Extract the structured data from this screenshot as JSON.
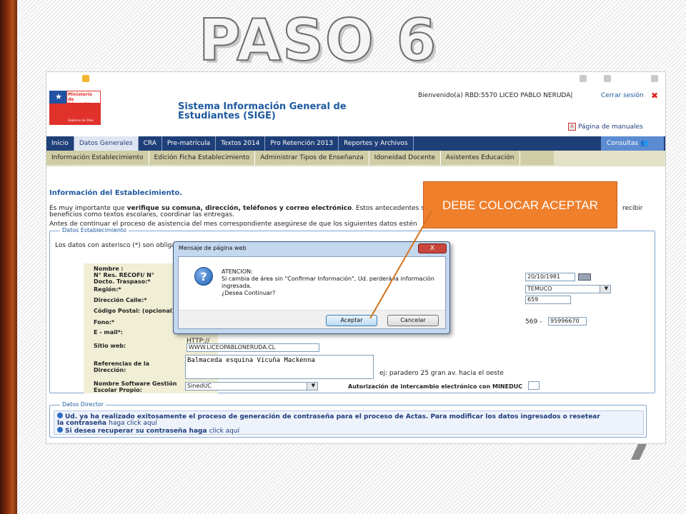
{
  "slide_title": "PASO 6",
  "callout": "DEBE COLOCAR ACEPTAR",
  "header": {
    "ministry": "Ministerio de Educación",
    "gov": "Gobierno de Chile",
    "system_name": "Sistema Información General de Estudiantes (SIGE)",
    "welcome": "Bienvenido(a) RBD:5570  LICEO PABLO NERUDA|",
    "logout": "Cerrar sesión",
    "manual": "Página de manuales"
  },
  "nav": {
    "tabs": [
      "Inicio",
      "Datos Generales",
      "CRA",
      "Pre-matrícula",
      "Textos 2014",
      "Pro Retención 2013",
      "Reportes y Archivos"
    ],
    "active": "Datos Generales",
    "consultas": "Consultas"
  },
  "subnav": [
    "Información Establecimiento",
    "Edición Ficha Establecimiento",
    "Administrar Tipos de Enseñanza",
    "Idoneidad Docente",
    "Asistentes Educación"
  ],
  "content": {
    "heading": "Información del Establecimiento.",
    "intro_a": "Es muy importante que",
    "intro_b": "verifique su comuna, dirección, teléfonos y correo electrónico",
    "intro_c": ". Estos antecedentes serán utilizados para el despacho de",
    "intro_d": "recibir",
    "intro_line2": "beneficios como textos escolares, coordinar las entregas.",
    "intro_line3": "Antes de continuar el proceso de asistencia del mes correspondiente asegúrese de que los siguientes datos estén",
    "fieldset_legend": "Datos Establecimiento",
    "asterisk_note": "Los datos con asterisco (*) son obligatorios",
    "labels": {
      "nombre": "Nombre :",
      "recofi": "N° Res. RECOFI/ N° Docto. Traspaso:*",
      "region": "Región:*",
      "direccion": "Dirección Calle:*",
      "postal": "Código Postal: (opcional)",
      "fono": "Fono:*",
      "email": "E - mail*:",
      "web": "Sitio web:",
      "referencias": "Referencias de la Dirección:",
      "software": "Nombre Software Gestión Escolar Propio:",
      "autorizacion": "Autorización de intercambio electrónico con MINEDUC"
    },
    "values": {
      "fecha": "20/10/1981",
      "comuna": "TEMUCO",
      "numero": "659",
      "fono_code": "569 -",
      "fono": "95996670",
      "http": "HTTP://",
      "web": "WWW.LICEOPABLONERUDA.CL",
      "referencias": "Balmaceda esquina Vicuña Mackenna",
      "ref_hint": "ej: paradero 25 gran av. hacia el oeste",
      "software": "SinedUC"
    },
    "director_legend": "Datos Director",
    "info_line1": "Ud. ya ha realizado exitosamente el proceso de generación de contraseña para el proceso de Actas. Para modificar los datos ingresados o resetear",
    "info_line1b": "la contraseña",
    "info_link1": "haga click aquí",
    "info_line2": "Si desea recuperar su contraseña haga",
    "info_link2": "click aquí"
  },
  "dialog": {
    "title": "Mensaje de página web",
    "heading": "ATENCION:",
    "message": "Si cambia de área sin \"Confirmar Información\", Ud. perderá la información ingresada.",
    "question": "¿Desea Continuar?",
    "accept": "Aceptar",
    "cancel": "Cancelar",
    "close": "X"
  },
  "colors": {
    "nav": "#1f3f78",
    "callout": "#ef7f2b",
    "link": "#1e5aa0"
  }
}
